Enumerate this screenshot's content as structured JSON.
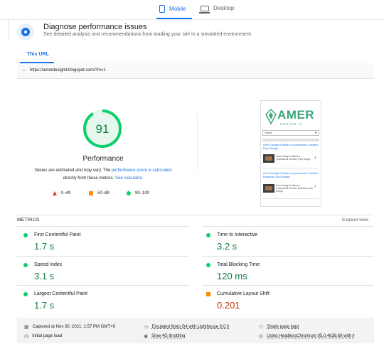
{
  "device_tabs": {
    "mobile_label": "Mobile",
    "desktop_label": "Desktop",
    "active": "mobile"
  },
  "header": {
    "title": "Diagnose performance issues",
    "subtitle": "See detailed analysis and recommendations from loading your site in a simulated environment."
  },
  "url_section": {
    "tab_label": "This URL",
    "url": "https://amerdesignit.blogspot.com/?m=1"
  },
  "score": {
    "value": 91,
    "display": "91",
    "fraction": 0.91,
    "label": "Performance",
    "note_line1_prefix": "Values are estimated and may vary. The ",
    "note_line1_link": "performance score is calculated",
    "note_line2_prefix": "directly from these metrics. ",
    "note_line2_link": "See calculator.",
    "color": "#0cce6b"
  },
  "legend": [
    {
      "range": "0–49",
      "shape": "triangle",
      "color": "#e53935"
    },
    {
      "range": "50–89",
      "shape": "square",
      "color": "#fb8c00"
    },
    {
      "range": "90–100",
      "shape": "circle",
      "color": "#0cce6b"
    }
  ],
  "preview": {
    "logo_text": "AMER",
    "logo_sub": "DESIGN IT",
    "menu_label": "Home",
    "posts": [
      {
        "title": "Amer Design It Makes a professional Creative Flyer Design",
        "desc": "Amer Design It Makes a professional Creative Flyer Design"
      },
      {
        "title": "Amer Design It Makes a professional Creative Business Card Design",
        "desc": "Amer Design It Makes a professional Creative Business Card Design"
      }
    ]
  },
  "metrics": {
    "section_label": "METRICS",
    "expand_label": "Expand view",
    "items": [
      {
        "name": "First Contentful Paint",
        "value": "1.7 s",
        "status": "good"
      },
      {
        "name": "Time to Interactive",
        "value": "3.2 s",
        "status": "good"
      },
      {
        "name": "Speed Index",
        "value": "3.1 s",
        "status": "good"
      },
      {
        "name": "Total Blocking Time",
        "value": "120 ms",
        "status": "good"
      },
      {
        "name": "Largest Contentful Paint",
        "value": "1.7 s",
        "status": "good"
      },
      {
        "name": "Cumulative Layout Shift",
        "value": "0.201",
        "status": "average"
      }
    ]
  },
  "footer": {
    "captured": "Captured at Nov 30, 2021, 1:57 PM GMT+6",
    "device": "Emulated Moto G4 with Lighthouse 9.0.0",
    "session": "Single page load",
    "initial": "Initial page load",
    "throttling": "Slow 4G throttling",
    "browser": "Using HeadlessChromium 95.0.4638.69 with lr"
  }
}
